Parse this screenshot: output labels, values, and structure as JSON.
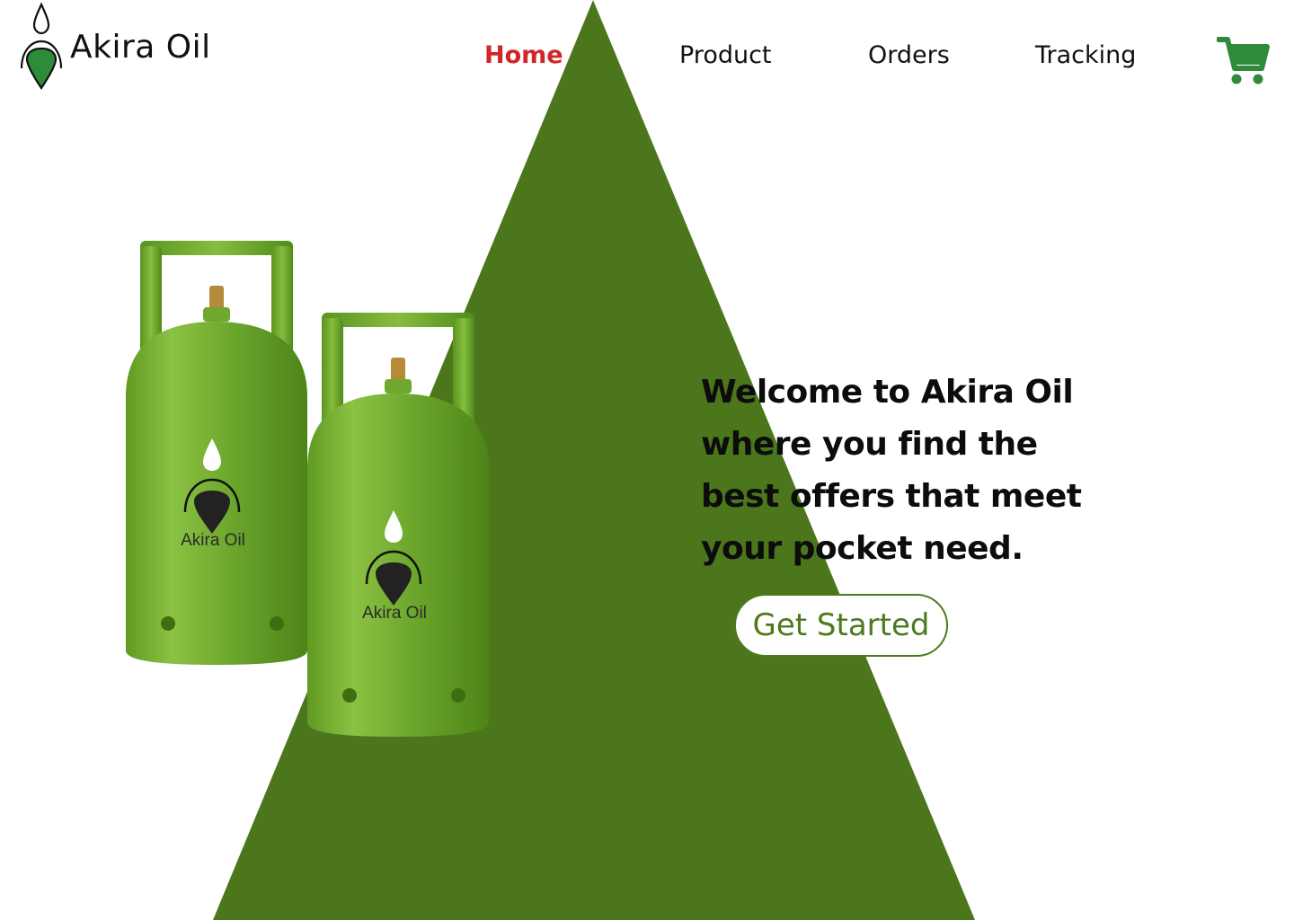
{
  "brand": {
    "name": "Akira Oil",
    "logo_icon": "oil-drop-pin-icon",
    "cylinder_label": "Akira Oil"
  },
  "nav": {
    "items": [
      {
        "label": "Home",
        "active": true
      },
      {
        "label": "Product",
        "active": false
      },
      {
        "label": "Orders",
        "active": false
      },
      {
        "label": "Tracking",
        "active": false
      }
    ],
    "cart_icon": "shopping-cart-icon"
  },
  "hero": {
    "headline": "Welcome to Akira Oil where you find the best offers that meet your pocket need.",
    "cta_label": "Get Started"
  },
  "colors": {
    "primary_green": "#4c761c",
    "active_nav": "#d0252b",
    "cart_green": "#2e8b3a",
    "cylinder_green": "#6aa52b"
  }
}
